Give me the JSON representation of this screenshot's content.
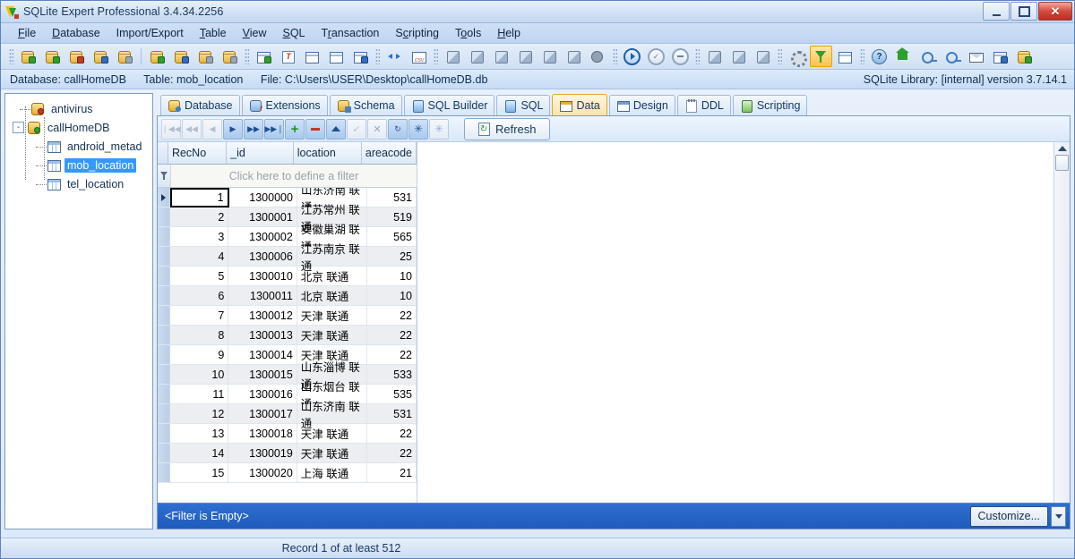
{
  "window": {
    "title": "SQLite Expert Professional 3.4.34.2256",
    "app_icon": "sqlite-expert-icon",
    "controls": {
      "minimize": "minimize-icon",
      "maximize": "maximize-icon",
      "close": "close-icon"
    }
  },
  "menu": [
    {
      "label": "File"
    },
    {
      "label": "Database"
    },
    {
      "label": "Import/Export"
    },
    {
      "label": "Table"
    },
    {
      "label": "View"
    },
    {
      "label": "SQL"
    },
    {
      "label": "Transaction"
    },
    {
      "label": "Scripting"
    },
    {
      "label": "Tools"
    },
    {
      "label": "Help"
    }
  ],
  "toolbar": {
    "groups": [
      {
        "buttons": [
          {
            "name": "open-database-icon"
          },
          {
            "name": "new-database-icon"
          },
          {
            "name": "close-database-icon"
          },
          {
            "name": "database-properties-icon"
          },
          {
            "name": "database-search-icon"
          }
        ]
      },
      {
        "buttons": [
          {
            "name": "attach-database-icon"
          },
          {
            "name": "detach-database-icon"
          },
          {
            "name": "backup-database-icon"
          },
          {
            "name": "edit-database-icon"
          }
        ]
      },
      {
        "buttons": [
          {
            "name": "new-table-icon"
          },
          {
            "name": "text-field-icon"
          },
          {
            "name": "refresh-schema-icon"
          },
          {
            "name": "grid-view-icon"
          },
          {
            "name": "import-data-icon"
          }
        ]
      },
      {
        "buttons": [
          {
            "name": "transfer-data-icon"
          },
          {
            "name": "export-csv-icon"
          }
        ]
      },
      {
        "buttons": [
          {
            "name": "run-sql-icon"
          },
          {
            "name": "sql-history-icon"
          },
          {
            "name": "sql-builder-icon"
          },
          {
            "name": "sql-plan-icon"
          },
          {
            "name": "sql-script-icon"
          },
          {
            "name": "sql-new-icon"
          },
          {
            "name": "stop-icon"
          }
        ]
      },
      {
        "buttons": [
          {
            "name": "execute-icon",
            "active": true
          },
          {
            "name": "commit-icon"
          },
          {
            "name": "rollback-icon"
          }
        ]
      },
      {
        "buttons": [
          {
            "name": "index-icon"
          },
          {
            "name": "trigger-icon"
          },
          {
            "name": "view-icon"
          }
        ]
      },
      {
        "buttons": [
          {
            "name": "options-gear-icon"
          },
          {
            "name": "filter-icon",
            "active": true
          },
          {
            "name": "column-layout-icon"
          }
        ]
      },
      {
        "buttons": [
          {
            "name": "help-icon"
          },
          {
            "name": "home-page-icon"
          },
          {
            "name": "support-icon"
          },
          {
            "name": "register-key-icon"
          },
          {
            "name": "email-icon"
          },
          {
            "name": "check-update-icon"
          },
          {
            "name": "about-icon"
          }
        ]
      }
    ]
  },
  "info_bar": {
    "database": "Database: callHomeDB",
    "table": "Table: mob_location",
    "file": "File: C:\\Users\\USER\\Desktop\\callHomeDB.db",
    "library": "SQLite Library: [internal] version 3.7.14.1"
  },
  "tree": {
    "nodes": [
      {
        "label": "antivirus",
        "type": "database",
        "level": 1,
        "selected": false,
        "expanded": false
      },
      {
        "label": "callHomeDB",
        "type": "database",
        "level": 1,
        "selected": false,
        "expanded": true,
        "expander": "-"
      },
      {
        "label": "android_metad",
        "type": "table",
        "level": 2,
        "selected": false
      },
      {
        "label": "mob_location",
        "type": "table",
        "level": 2,
        "selected": true
      },
      {
        "label": "tel_location",
        "type": "table",
        "level": 2,
        "selected": false
      }
    ]
  },
  "tabs": [
    {
      "label": "Database",
      "icon": "database-tab-icon",
      "active": false
    },
    {
      "label": "Extensions",
      "icon": "extensions-tab-icon",
      "active": false
    },
    {
      "label": "Schema",
      "icon": "schema-tab-icon",
      "active": false
    },
    {
      "label": "SQL Builder",
      "icon": "sql-builder-tab-icon",
      "active": false
    },
    {
      "label": "SQL",
      "icon": "sql-tab-icon",
      "active": false
    },
    {
      "label": "Data",
      "icon": "data-tab-icon",
      "active": true
    },
    {
      "label": "Design",
      "icon": "design-tab-icon",
      "active": false
    },
    {
      "label": "DDL",
      "icon": "ddl-tab-icon",
      "active": false
    },
    {
      "label": "Scripting",
      "icon": "scripting-tab-icon",
      "active": false
    }
  ],
  "navigator": {
    "buttons": [
      {
        "name": "first-record-button",
        "glyph": "|◀◀",
        "enabled": false
      },
      {
        "name": "prior-page-button",
        "glyph": "◀◀",
        "enabled": false
      },
      {
        "name": "prior-record-button",
        "glyph": "◀",
        "enabled": false
      },
      {
        "name": "next-record-button",
        "glyph": "▶",
        "enabled": true
      },
      {
        "name": "next-page-button",
        "glyph": "▶▶",
        "enabled": true
      },
      {
        "name": "last-record-button",
        "glyph": "▶▶|",
        "enabled": true
      },
      {
        "name": "insert-record-button",
        "glyph": "+",
        "enabled": true
      },
      {
        "name": "delete-record-button",
        "glyph": "−",
        "enabled": true
      },
      {
        "name": "edit-record-button",
        "glyph": "▲",
        "enabled": true
      },
      {
        "name": "post-edit-button",
        "glyph": "✓",
        "enabled": false
      },
      {
        "name": "cancel-edit-button",
        "glyph": "✕",
        "enabled": false
      },
      {
        "name": "refresh-record-button",
        "glyph": "↻",
        "enabled": true
      },
      {
        "name": "set-null-button",
        "glyph": "✳",
        "enabled": true
      },
      {
        "name": "clear-null-button",
        "glyph": "✳",
        "enabled": false
      }
    ],
    "refresh_label": "Refresh"
  },
  "grid": {
    "columns": [
      "RecNo",
      "_id",
      "location",
      "areacode"
    ],
    "filter_placeholder": "Click here to define a filter",
    "rows": [
      {
        "RecNo": "1",
        "_id": "1300000",
        "location": "山东济南 联通",
        "areacode": "531",
        "current": true
      },
      {
        "RecNo": "2",
        "_id": "1300001",
        "location": "江苏常州 联通",
        "areacode": "519"
      },
      {
        "RecNo": "3",
        "_id": "1300002",
        "location": "安徽巢湖 联通",
        "areacode": "565"
      },
      {
        "RecNo": "4",
        "_id": "1300006",
        "location": "江苏南京 联通",
        "areacode": "25"
      },
      {
        "RecNo": "5",
        "_id": "1300010",
        "location": "北京 联通",
        "areacode": "10"
      },
      {
        "RecNo": "6",
        "_id": "1300011",
        "location": "北京 联通",
        "areacode": "10"
      },
      {
        "RecNo": "7",
        "_id": "1300012",
        "location": "天津 联通",
        "areacode": "22"
      },
      {
        "RecNo": "8",
        "_id": "1300013",
        "location": "天津 联通",
        "areacode": "22"
      },
      {
        "RecNo": "9",
        "_id": "1300014",
        "location": "天津 联通",
        "areacode": "22"
      },
      {
        "RecNo": "10",
        "_id": "1300015",
        "location": "山东淄博 联通",
        "areacode": "533"
      },
      {
        "RecNo": "11",
        "_id": "1300016",
        "location": "山东烟台 联通",
        "areacode": "535"
      },
      {
        "RecNo": "12",
        "_id": "1300017",
        "location": "山东济南 联通",
        "areacode": "531"
      },
      {
        "RecNo": "13",
        "_id": "1300018",
        "location": "天津 联通",
        "areacode": "22"
      },
      {
        "RecNo": "14",
        "_id": "1300019",
        "location": "天津 联通",
        "areacode": "22"
      },
      {
        "RecNo": "15",
        "_id": "1300020",
        "location": "上海 联通",
        "areacode": "21"
      }
    ]
  },
  "filter_bar": {
    "text": "<Filter is Empty>",
    "customize_label": "Customize..."
  },
  "status_bar": {
    "record_info": "Record 1 of at least 512"
  },
  "colors": {
    "accent_blue": "#2f6fd0",
    "selection_blue": "#3399ff",
    "active_tab": "#ffe3a8",
    "title_text": "#17365d"
  }
}
